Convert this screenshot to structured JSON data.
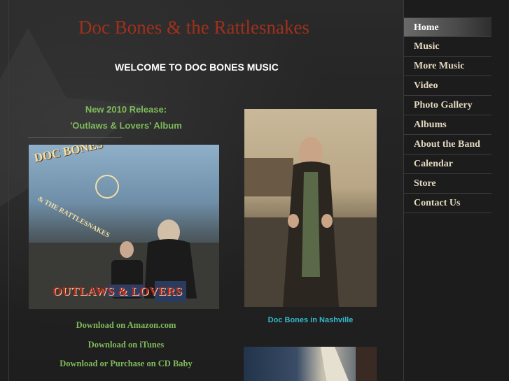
{
  "site": {
    "title": "Doc Bones & the Rattlesnakes",
    "welcome": "WELCOME TO DOC BONES MUSIC"
  },
  "release": {
    "heading": "New 2010 Release:",
    "album_line": "'Outlaws & Lovers' Album",
    "cover": {
      "band_name": "DOC BONES",
      "band_sub": "& THE RATTLESNAKES",
      "album_title": "OUTLAWS & LOVERS"
    }
  },
  "downloads": [
    {
      "label": "Download on Amazon.com"
    },
    {
      "label": "Download on iTunes"
    },
    {
      "label": "Download or Purchase on CD Baby"
    }
  ],
  "photo": {
    "caption": "Doc Bones in Nashville"
  },
  "nav": {
    "items": [
      {
        "label": "Home",
        "active": true
      },
      {
        "label": "Music"
      },
      {
        "label": "More Music"
      },
      {
        "label": "Video"
      },
      {
        "label": "Photo Gallery"
      },
      {
        "label": "Albums"
      },
      {
        "label": "About the Band"
      },
      {
        "label": "Calendar"
      },
      {
        "label": "Store"
      },
      {
        "label": "Contact Us"
      }
    ]
  },
  "colors": {
    "title": "#a0301c",
    "link_green": "#7fba5a",
    "caption_cyan": "#35b8c8",
    "nav_text": "#e4d8bf"
  }
}
